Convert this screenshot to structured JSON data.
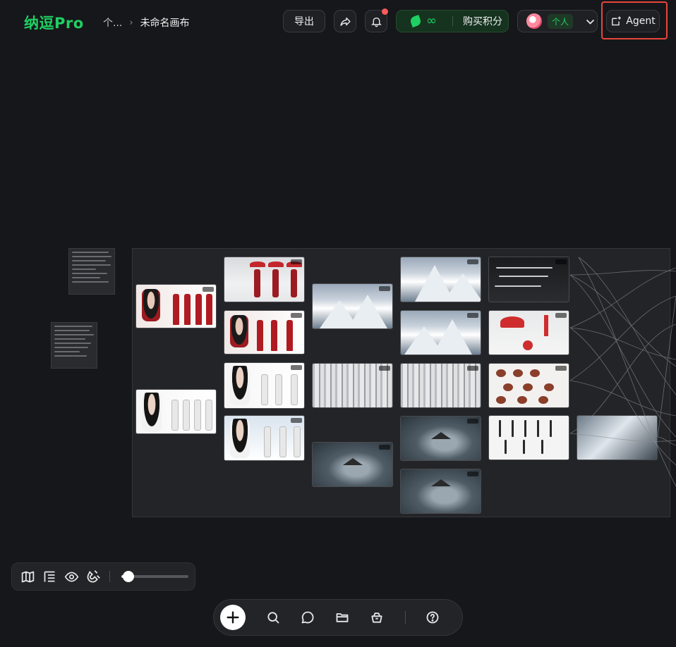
{
  "app": {
    "logo": "纳逗Pro"
  },
  "breadcrumb": {
    "parent": "个...",
    "separator": "›",
    "current": "未命名画布"
  },
  "header": {
    "export_label": "导出",
    "credits": {
      "amount": "∞",
      "buy_label": "购买积分"
    },
    "user": {
      "plan_tag": "个人"
    },
    "agent_label": "Agent"
  },
  "colors": {
    "brand": "#1fcf63",
    "background": "#16171a",
    "highlight": "#e8453c",
    "notification": "#ff5b5b"
  },
  "icons": {
    "share": "share-arrow-icon",
    "bell": "bell-icon",
    "credits": "leaf-icon",
    "chevron": "chevron-down-icon",
    "agent": "agent-sparkle-icon",
    "map": "map-icon",
    "layout": "layout-list-icon",
    "eye": "eye-icon",
    "magnet": "magnet-icon",
    "plus": "plus-icon",
    "search": "search-icon",
    "chat": "chat-bubble-icon",
    "folder": "folder-icon",
    "basket": "asset-basket-icon",
    "help": "help-icon"
  },
  "toolbar": {
    "zoom_fraction": 0.1
  }
}
